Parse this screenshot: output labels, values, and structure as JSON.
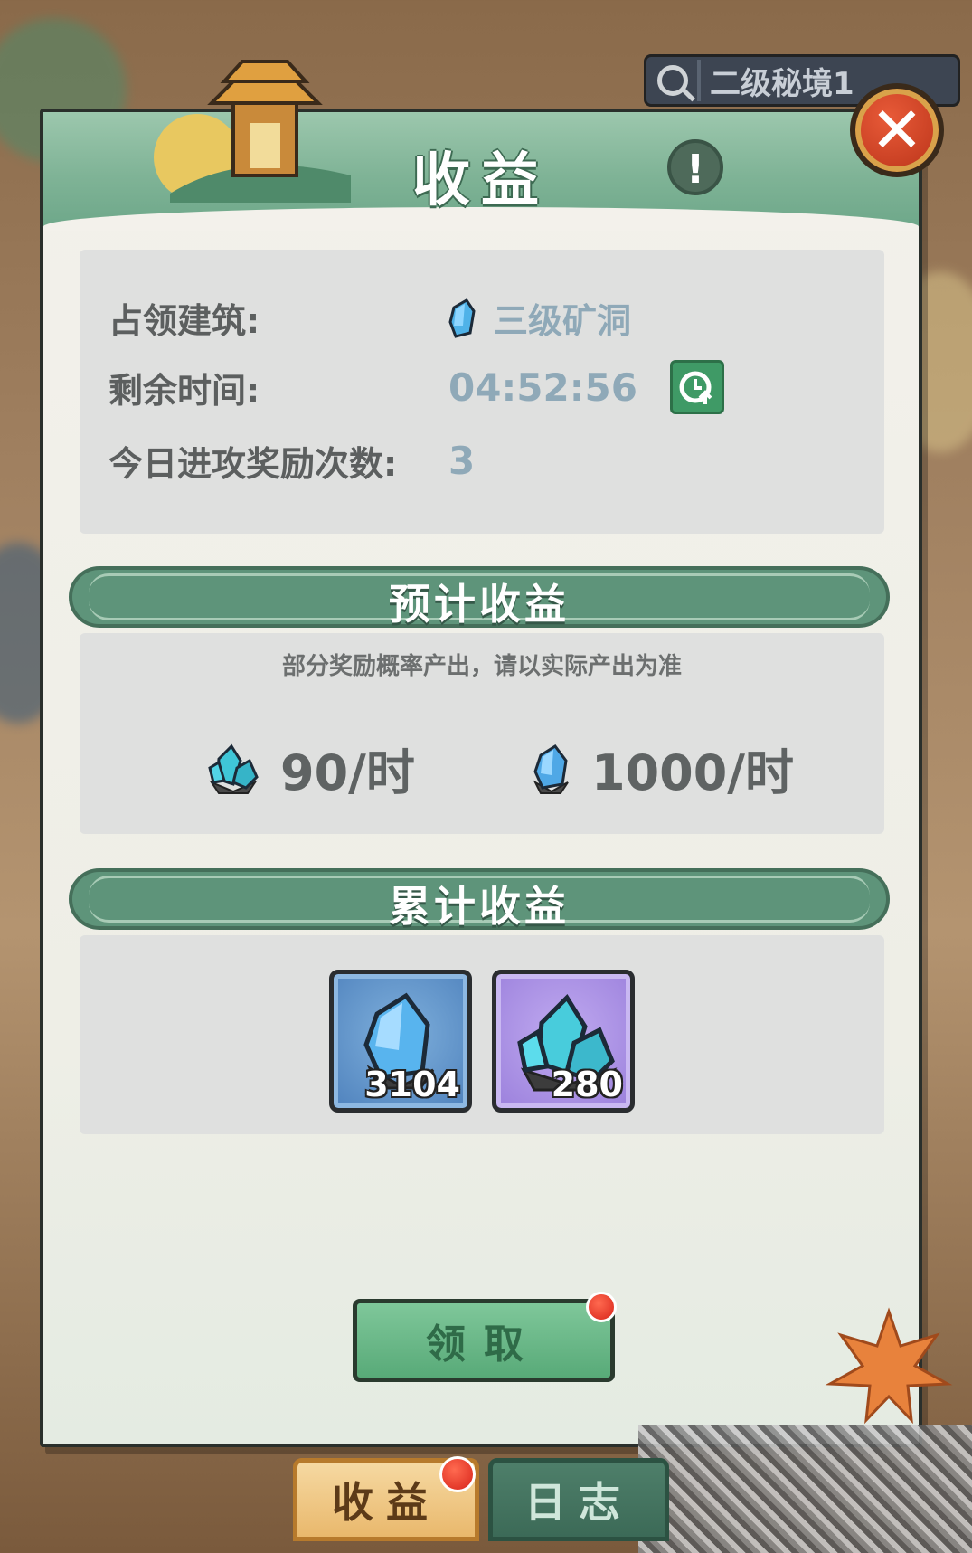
{
  "background": {
    "search_label": "二级秘境1"
  },
  "panel": {
    "title": "收益"
  },
  "info": {
    "building_label": "占领建筑:",
    "building_value": "三级矿洞",
    "time_label": "剩余时间:",
    "time_value": "04:52:56",
    "attack_label": "今日进攻奖励次数:",
    "attack_value": "3"
  },
  "expected": {
    "header": "预计收益",
    "note": "部分奖励概率产出，请以实际产出为准",
    "rates": [
      {
        "icon": "crystal-cluster-icon",
        "value": "90/时"
      },
      {
        "icon": "blue-gem-icon",
        "value": "1000/时"
      }
    ]
  },
  "accumulated": {
    "header": "累计收益",
    "items": [
      {
        "icon": "blue-gem-icon",
        "count": "3104",
        "rarity": "blue"
      },
      {
        "icon": "crystal-cluster-icon",
        "count": "280",
        "rarity": "purple"
      }
    ]
  },
  "claim_label": "领取",
  "tabs": [
    {
      "label": "收益",
      "active": true
    },
    {
      "label": "日志",
      "active": false
    }
  ],
  "colors": {
    "accent_green": "#5e947a",
    "button_green": "#58aa78",
    "alert_red": "#d8241a"
  }
}
